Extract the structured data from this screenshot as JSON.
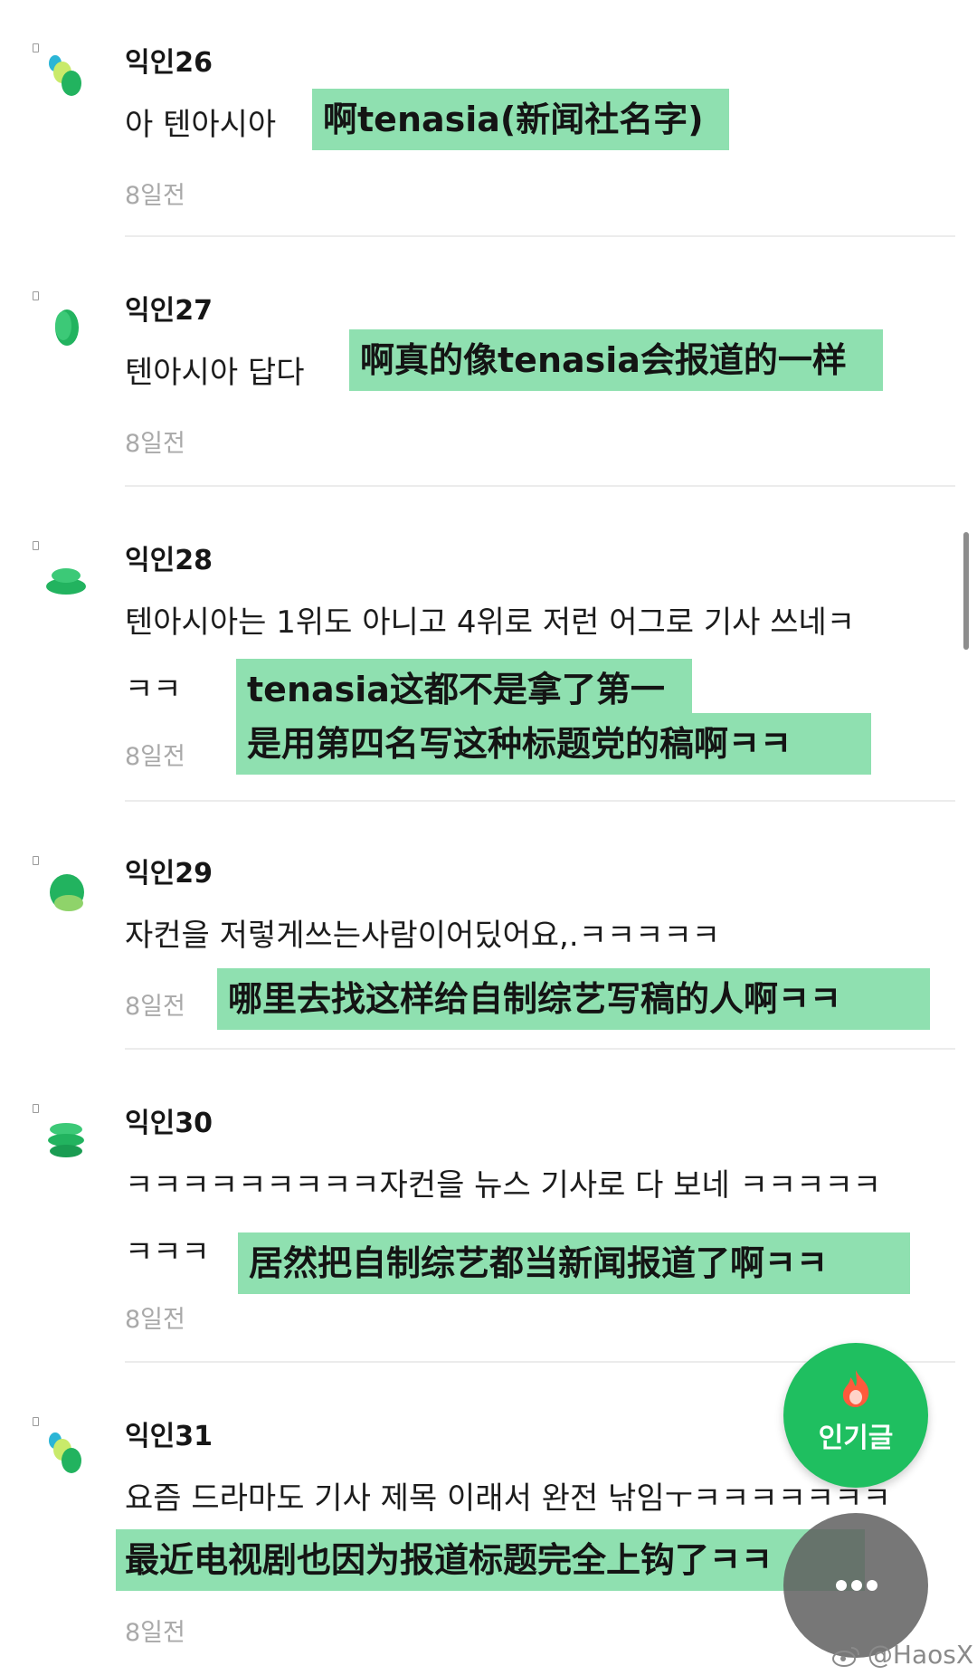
{
  "comments": [
    {
      "author": "익인26",
      "text_lines": [
        "아 텐아시아"
      ],
      "time": "8일전",
      "translation_lines": [
        "啊tenasia(新闻社名字)"
      ]
    },
    {
      "author": "익인27",
      "text_lines": [
        "텐아시아 답다"
      ],
      "time": "8일전",
      "translation_lines": [
        "啊真的像tenasia会报道的一样"
      ]
    },
    {
      "author": "익인28",
      "text_lines": [
        "텐아시아는 1위도 아니고 4위로 저런 어그로 기사 쓰네ㅋ",
        "ㅋㅋ"
      ],
      "time": "8일전",
      "translation_lines": [
        "tenasia这都不是拿了第一",
        "是用第四名写这种标题党的稿啊ㅋㅋ"
      ]
    },
    {
      "author": "익인29",
      "text_lines": [
        "자컨을 저렇게쓰는사람이어딨어요,.ㅋㅋㅋㅋㅋ"
      ],
      "time": "8일전",
      "translation_lines": [
        "哪里去找这样给自制综艺写稿的人啊ㅋㅋ"
      ]
    },
    {
      "author": "익인30",
      "text_lines": [
        "ㅋㅋㅋㅋㅋㅋㅋㅋㅋ자컨을 뉴스 기사로 다 보네 ㅋㅋㅋㅋㅋ",
        "ㅋㅋㅋ"
      ],
      "time": "8일전",
      "translation_lines": [
        "居然把自制综艺都当新闻报道了啊ㅋㅋ"
      ]
    },
    {
      "author": "익인31",
      "text_lines": [
        "요즘 드라마도 기사 제목 이래서 완전 낚임ㅜㅋㅋㅋㅋㅋㅋㅋ"
      ],
      "time": "8일전",
      "translation_lines": [
        "最近电视剧也因为报道标题完全上钩了ㅋㅋ"
      ]
    }
  ],
  "fab": {
    "popular_label": "인기글"
  },
  "watermark": "@HaosX",
  "colors": {
    "highlight": "#8fe0b0",
    "fab_green": "#1fbf60",
    "divider": "#ececec"
  },
  "icons": {
    "fab_popular": "fire-icon",
    "fab_more": "more-dots-icon",
    "watermark": "weibo-icon"
  }
}
